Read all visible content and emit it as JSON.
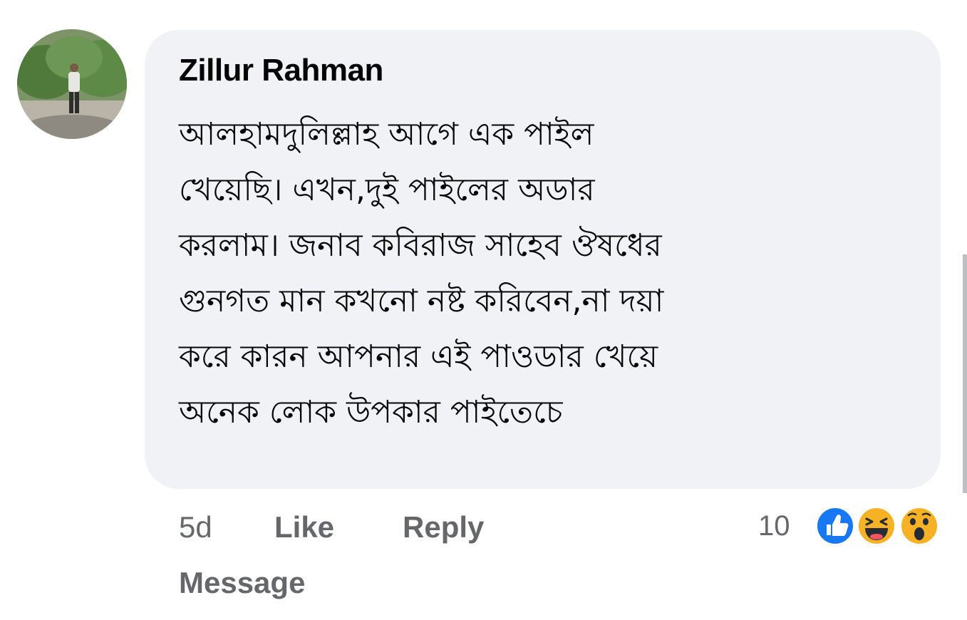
{
  "comment": {
    "author": "Zillur Rahman",
    "body_lines": [
      "আলহামদুলিল্লাহ আগে এক পাইল",
      "খেয়েছি। এখন,দুই পাইলের অডার",
      "করলাম। জনাব কবিরাজ সাহেব ঔষধের",
      "গুনগত মান কখনো নষ্ট করিবেন,না দয়া",
      "করে কারন আপনার এই পাওডার খেয়ে",
      "অনেক লোক উপকার পাইতেচে"
    ],
    "timestamp": "5d",
    "like_label": "Like",
    "reply_label": "Reply",
    "message_label": "Message",
    "reaction_count": "10",
    "reaction_icons": [
      "like-icon",
      "haha-icon",
      "wow-icon"
    ]
  },
  "colors": {
    "bubble": "#f0f2f5",
    "text": "#050505",
    "secondary": "#65676b",
    "like_blue": "#1877f2",
    "reaction_yellow": "#f7b125"
  }
}
